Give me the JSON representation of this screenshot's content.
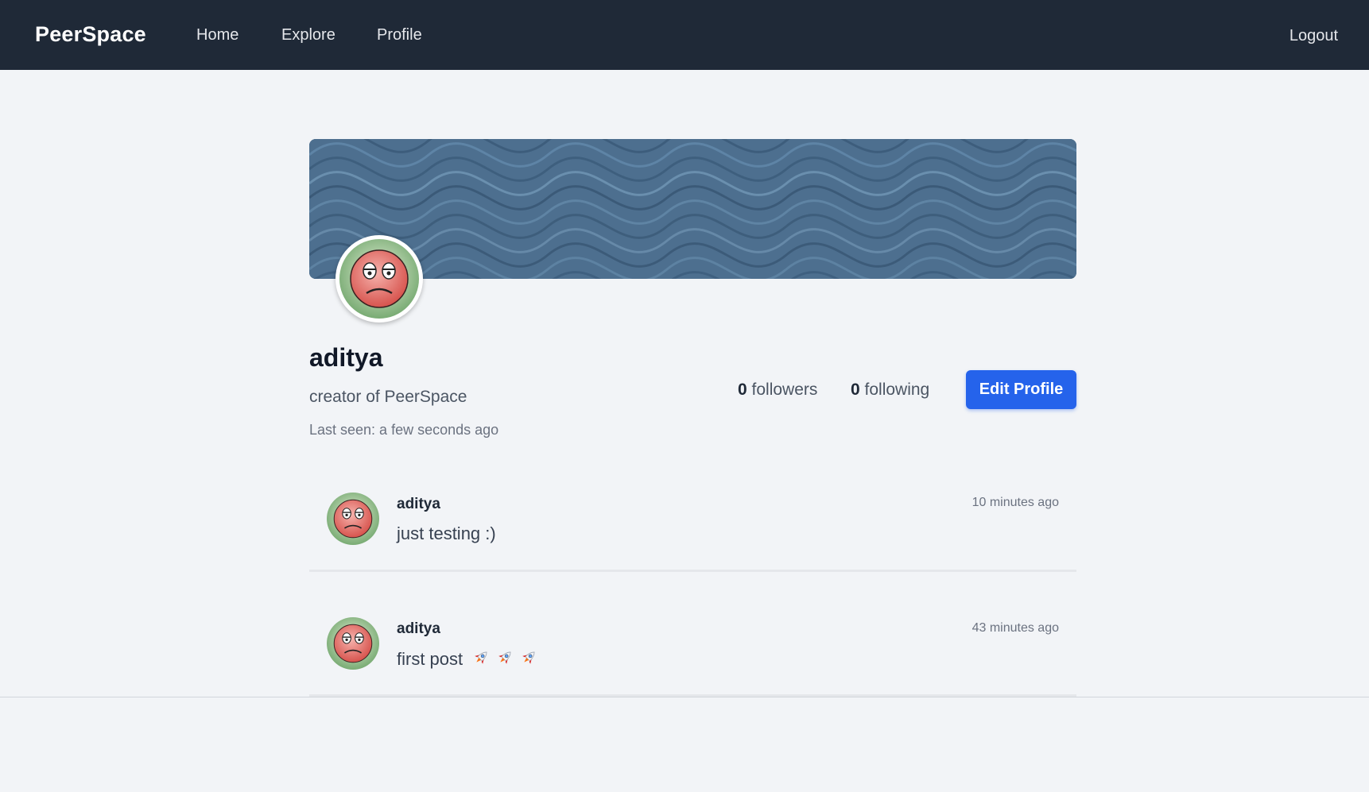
{
  "navbar": {
    "brand": "PeerSpace",
    "links": [
      "Home",
      "Explore",
      "Profile"
    ],
    "logout_label": "Logout"
  },
  "profile": {
    "username": "aditya",
    "bio": "creator of PeerSpace",
    "last_seen": "Last seen: a few seconds ago",
    "followers_count": "0",
    "followers_label": " followers",
    "following_count": "0",
    "following_label": " following",
    "edit_label": "Edit Profile"
  },
  "posts": [
    {
      "author": "aditya",
      "text": "just testing :)",
      "time": "10 minutes ago"
    },
    {
      "author": "aditya",
      "text": "first post",
      "time": "43 minutes ago",
      "emoji_icon": "rocket-icon",
      "emoji_count": 3
    }
  ],
  "colors": {
    "navbar": "#1f2937",
    "accent": "#2563eb",
    "background": "#f2f4f7",
    "banner": "#4a6c8c"
  }
}
